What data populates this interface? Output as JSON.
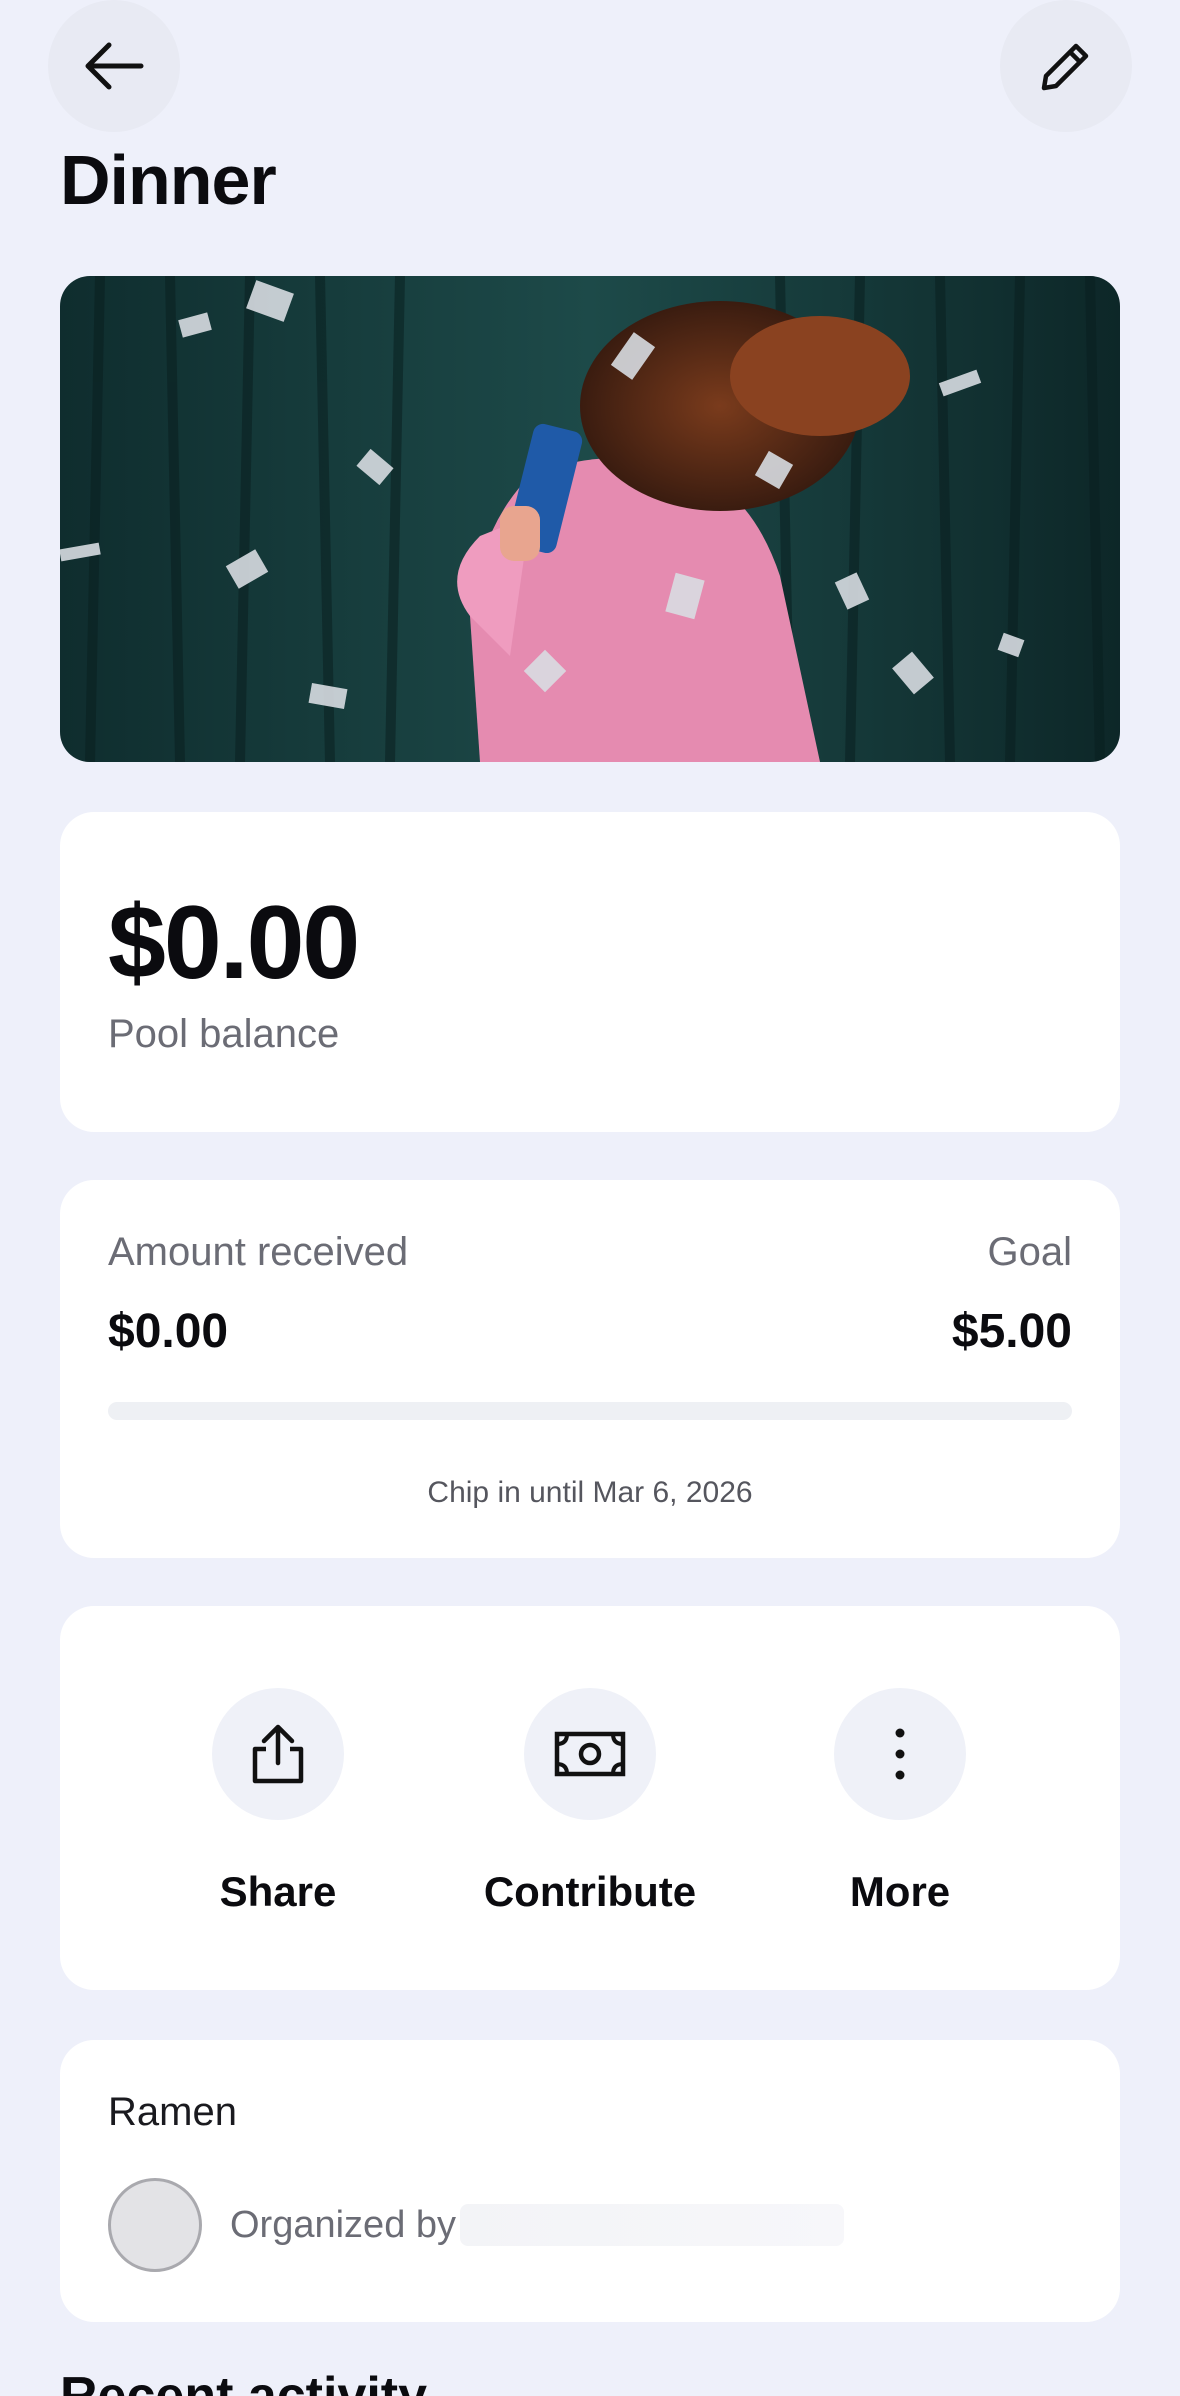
{
  "header": {
    "back_icon": "arrow-left-icon",
    "edit_icon": "pencil-icon",
    "title": "Dinner"
  },
  "hero": {
    "icon": "party-photo"
  },
  "balance": {
    "amount": "$0.00",
    "label": "Pool balance"
  },
  "goal": {
    "received_label": "Amount received",
    "received_value": "$0.00",
    "goal_label": "Goal",
    "goal_value": "$5.00",
    "progress": 0.0,
    "deadline": "Chip in until Mar 6, 2026",
    "accent_color": "#1a7cff"
  },
  "actions": [
    {
      "label": "Share",
      "icon": "share-icon"
    },
    {
      "label": "Contribute",
      "icon": "cash-icon"
    },
    {
      "label": "More",
      "icon": "more-vertical-icon"
    }
  ],
  "pool": {
    "name": "Ramen",
    "organizer_prefix": "Organized by"
  },
  "activity": {
    "heading": "Recent activity"
  }
}
